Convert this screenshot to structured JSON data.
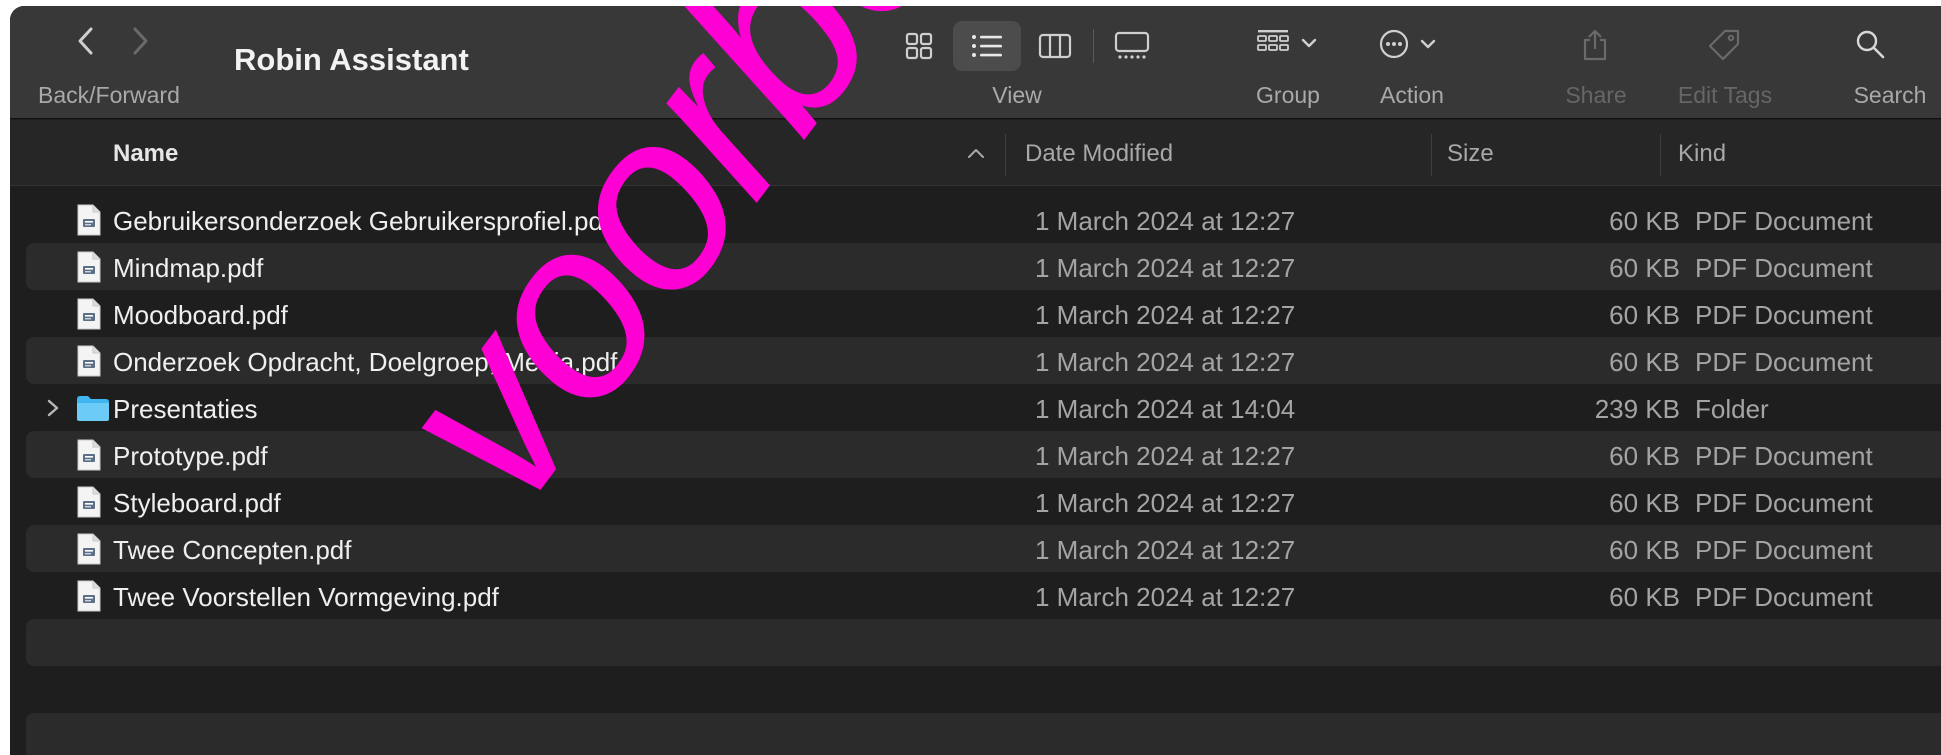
{
  "window": {
    "title": "Robin Assistant"
  },
  "toolbar": {
    "back_forward_label": "Back/Forward",
    "view_label": "View",
    "group_label": "Group",
    "action_label": "Action",
    "share_label": "Share",
    "edit_tags_label": "Edit Tags",
    "search_label": "Search",
    "active_view": "list"
  },
  "columns": {
    "name": "Name",
    "date_modified": "Date Modified",
    "size": "Size",
    "kind": "Kind"
  },
  "files": [
    {
      "name": "Gebruikersonderzoek Gebruikersprofiel.pdf",
      "date": "1 March 2024 at 12:27",
      "size": "60 KB",
      "kind": "PDF Document",
      "icon": "pdf-document-icon"
    },
    {
      "name": "Mindmap.pdf",
      "date": "1 March 2024 at 12:27",
      "size": "60 KB",
      "kind": "PDF Document",
      "icon": "pdf-document-icon"
    },
    {
      "name": "Moodboard.pdf",
      "date": "1 March 2024 at 12:27",
      "size": "60 KB",
      "kind": "PDF Document",
      "icon": "pdf-document-icon"
    },
    {
      "name": "Onderzoek Opdracht, Doelgroep, Media.pdf",
      "date": "1 March 2024 at 12:27",
      "size": "60 KB",
      "kind": "PDF Document",
      "icon": "pdf-document-icon"
    },
    {
      "name": "Presentaties",
      "date": "1 March 2024 at 14:04",
      "size": "239 KB",
      "kind": "Folder",
      "icon": "folder-icon"
    },
    {
      "name": "Prototype.pdf",
      "date": "1 March 2024 at 12:27",
      "size": "60 KB",
      "kind": "PDF Document",
      "icon": "pdf-document-icon"
    },
    {
      "name": "Styleboard.pdf",
      "date": "1 March 2024 at 12:27",
      "size": "60 KB",
      "kind": "PDF Document",
      "icon": "pdf-document-icon"
    },
    {
      "name": "Twee Concepten.pdf",
      "date": "1 March 2024 at 12:27",
      "size": "60 KB",
      "kind": "PDF Document",
      "icon": "pdf-document-icon"
    },
    {
      "name": "Twee Voorstellen Vormgeving.pdf",
      "date": "1 March 2024 at 12:27",
      "size": "60 KB",
      "kind": "PDF Document",
      "icon": "pdf-document-icon"
    }
  ],
  "watermark": {
    "text": "voorbeeld",
    "color": "#ff00d4"
  },
  "colors": {
    "window_background": "#1e1e1e",
    "toolbar_background": "#383838",
    "folder_blue": "#3fb6f0"
  }
}
